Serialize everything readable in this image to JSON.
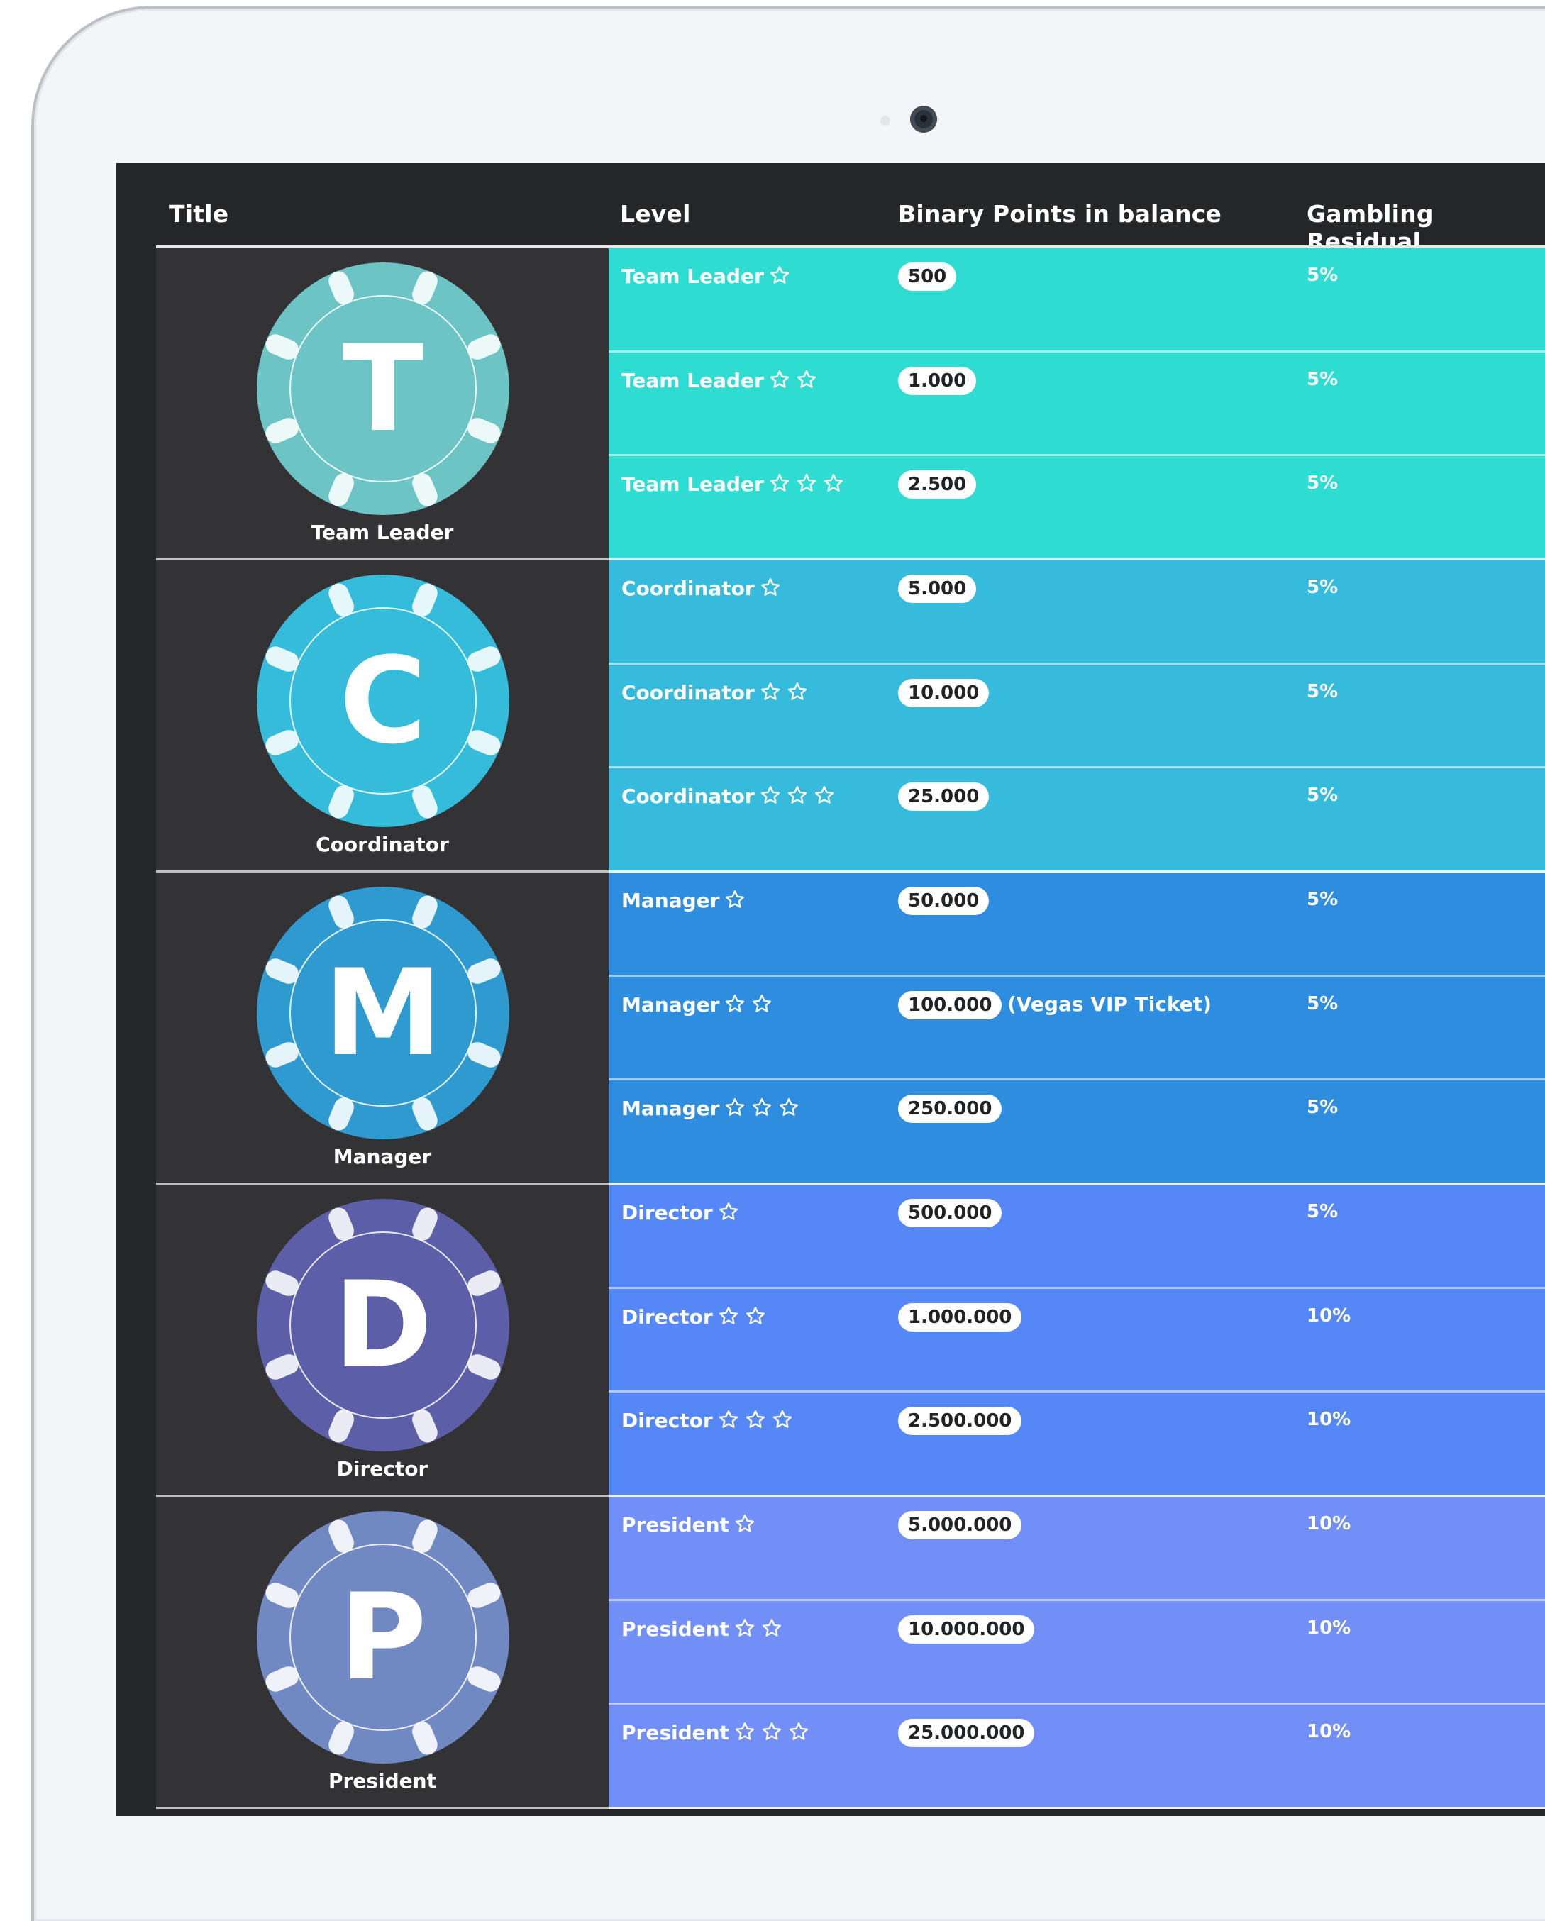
{
  "table": {
    "headers": {
      "title": "Title",
      "level": "Level",
      "points": "Binary Points in balance",
      "residual": "Gambling Residual"
    },
    "groups": [
      {
        "name": "Team Leader",
        "letter": "T",
        "chip_color": "#6cc4c5",
        "row_color": "#2edcd1",
        "rows": [
          {
            "level": "Team Leader",
            "stars": 1,
            "points": "500",
            "note": "",
            "residual": "5%"
          },
          {
            "level": "Team Leader",
            "stars": 2,
            "points": "1.000",
            "note": "",
            "residual": "5%"
          },
          {
            "level": "Team Leader",
            "stars": 3,
            "points": "2.500",
            "note": "",
            "residual": "5%"
          }
        ]
      },
      {
        "name": "Coordinator",
        "letter": "C",
        "chip_color": "#35bcdb",
        "row_color": "#36bbdd",
        "rows": [
          {
            "level": "Coordinator",
            "stars": 1,
            "points": "5.000",
            "note": "",
            "residual": "5%"
          },
          {
            "level": "Coordinator",
            "stars": 2,
            "points": "10.000",
            "note": "",
            "residual": "5%"
          },
          {
            "level": "Coordinator",
            "stars": 3,
            "points": "25.000",
            "note": "",
            "residual": "5%"
          }
        ]
      },
      {
        "name": "Manager",
        "letter": "M",
        "chip_color": "#2f9ad0",
        "row_color": "#2e8ddf",
        "rows": [
          {
            "level": "Manager",
            "stars": 1,
            "points": "50.000",
            "note": "",
            "residual": "5%"
          },
          {
            "level": "Manager",
            "stars": 2,
            "points": "100.000",
            "note": "(Vegas VIP Ticket)",
            "residual": "5%"
          },
          {
            "level": "Manager",
            "stars": 3,
            "points": "250.000",
            "note": "",
            "residual": "5%"
          }
        ]
      },
      {
        "name": "Director",
        "letter": "D",
        "chip_color": "#5c5fa8",
        "row_color": "#5588f6",
        "rows": [
          {
            "level": "Director",
            "stars": 1,
            "points": "500.000",
            "note": "",
            "residual": "5%"
          },
          {
            "level": "Director",
            "stars": 2,
            "points": "1.000.000",
            "note": "",
            "residual": "10%"
          },
          {
            "level": "Director",
            "stars": 3,
            "points": "2.500.000",
            "note": "",
            "residual": "10%"
          }
        ]
      },
      {
        "name": "President",
        "letter": "P",
        "chip_color": "#7089c2",
        "row_color": "#728ff8",
        "rows": [
          {
            "level": "President",
            "stars": 1,
            "points": "5.000.000",
            "note": "",
            "residual": "10%"
          },
          {
            "level": "President",
            "stars": 2,
            "points": "10.000.000",
            "note": "",
            "residual": "10%"
          },
          {
            "level": "President",
            "stars": 3,
            "points": "25.000.000",
            "note": "",
            "residual": "10%"
          }
        ]
      }
    ]
  },
  "icons": {
    "star": "star-outline-icon",
    "chip": "poker-chip-icon"
  }
}
